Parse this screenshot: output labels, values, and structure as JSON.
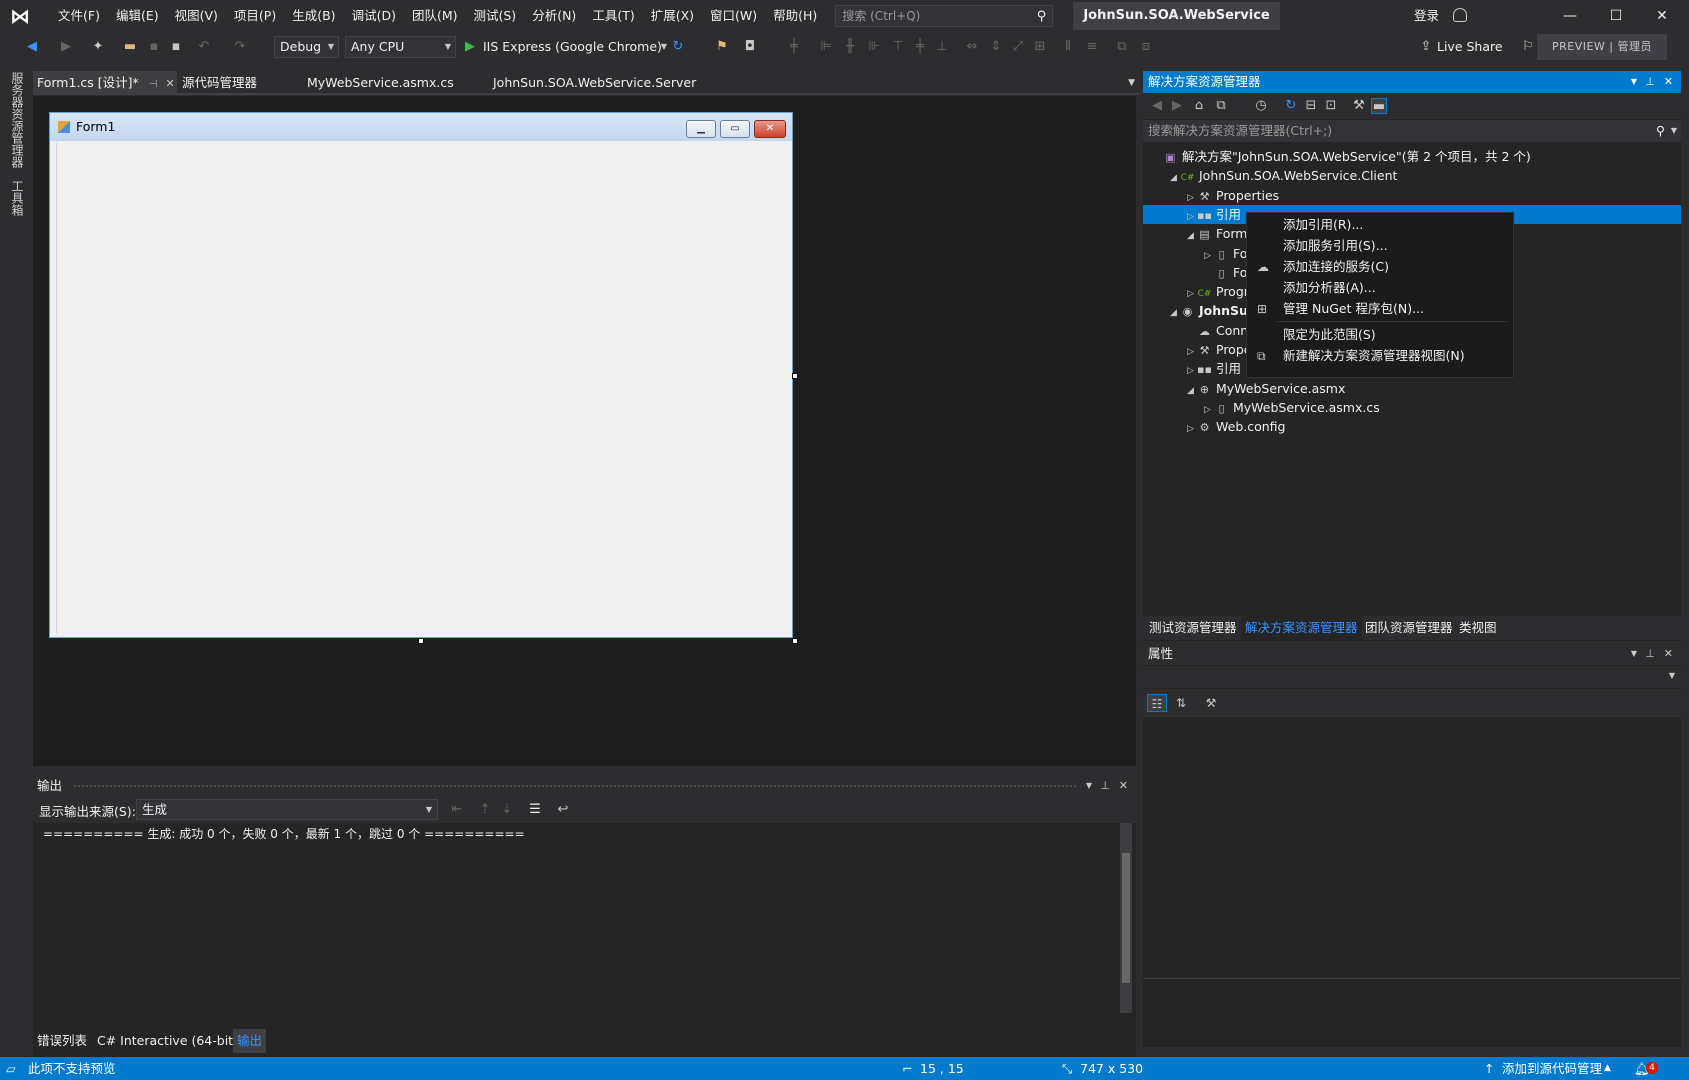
{
  "titlebar": {
    "menus": [
      "文件(F)",
      "编辑(E)",
      "视图(V)",
      "项目(P)",
      "生成(B)",
      "调试(D)",
      "团队(M)",
      "测试(S)",
      "分析(N)",
      "工具(T)",
      "扩展(X)",
      "窗口(W)",
      "帮助(H)"
    ],
    "search_placeholder": "搜索 (Ctrl+Q)",
    "solution_name": "JohnSun.SOA.WebService",
    "login": "登录"
  },
  "toolbar": {
    "config": "Debug",
    "platform": "Any CPU",
    "run_target": "IIS Express (Google Chrome)",
    "live_share": "Live Share",
    "preview": "PREVIEW | 管理员"
  },
  "leftbar": {
    "server_explorer": "服务器资源管理器",
    "toolbox": "工具箱"
  },
  "doc_tabs": [
    {
      "label": "Form1.cs [设计]*",
      "active": true
    },
    {
      "label": "源代码管理器",
      "active": false
    },
    {
      "label": "MyWebService.asmx.cs",
      "active": false
    },
    {
      "label": "JohnSun.SOA.WebService.Server",
      "active": false
    }
  ],
  "designer": {
    "form_title": "Form1"
  },
  "output": {
    "title": "输出",
    "source_label": "显示输出来源(S):",
    "source_value": "生成",
    "line": "========== 生成: 成功 0 个，失败 0 个，最新 1 个，跳过 0 个 =========="
  },
  "bottom_tabs": [
    "错误列表",
    "C# Interactive (64-bit)",
    "输出"
  ],
  "solution_explorer": {
    "title": "解决方案资源管理器",
    "search_placeholder": "搜索解决方案资源管理器(Ctrl+;)",
    "tree": [
      {
        "label": "解决方案\"JohnSun.SOA.WebService\"(第 2 个项目，共 2 个)",
        "icon": "solution-icon",
        "depth": 0,
        "expander": ""
      },
      {
        "label": "JohnSun.SOA.WebService.Client",
        "icon": "csharp-project-icon",
        "depth": 1,
        "expander": "◢"
      },
      {
        "label": "Properties",
        "icon": "wrench-icon",
        "depth": 2,
        "expander": "▷"
      },
      {
        "label": "引用",
        "icon": "references-icon",
        "depth": 2,
        "expander": "▷",
        "selected": true
      },
      {
        "label": "Form1.cs",
        "icon": "form-icon",
        "depth": 2,
        "expander": "◢"
      },
      {
        "label": "Form1.Designer.cs",
        "icon": "file-icon",
        "depth": 3,
        "expander": "▷"
      },
      {
        "label": "Form1.resx",
        "icon": "file-icon",
        "depth": 3,
        "expander": ""
      },
      {
        "label": "Program.cs",
        "icon": "csharp-file-icon",
        "depth": 2,
        "expander": "▷"
      },
      {
        "label": "JohnSun.SOA.WebService.Server",
        "icon": "web-project-icon",
        "depth": 1,
        "expander": "◢",
        "bold": true
      },
      {
        "label": "Connected Services",
        "icon": "connected-services-icon",
        "depth": 2,
        "expander": ""
      },
      {
        "label": "Properties",
        "icon": "wrench-icon",
        "depth": 2,
        "expander": "▷"
      },
      {
        "label": "引用",
        "icon": "references-icon",
        "depth": 2,
        "expander": "▷"
      },
      {
        "label": "MyWebService.asmx",
        "icon": "globe-icon",
        "depth": 2,
        "expander": "◢"
      },
      {
        "label": "MyWebService.asmx.cs",
        "icon": "file-icon",
        "depth": 3,
        "expander": "▷"
      },
      {
        "label": "Web.config",
        "icon": "config-icon",
        "depth": 2,
        "expander": "▷"
      }
    ],
    "tabs": [
      "测试资源管理器",
      "解决方案资源管理器",
      "团队资源管理器",
      "类视图"
    ]
  },
  "context_menu": [
    {
      "label": "添加引用(R)...",
      "icon": ""
    },
    {
      "label": "添加服务引用(S)...",
      "icon": ""
    },
    {
      "label": "添加连接的服务(C)",
      "icon": "connected-services-icon"
    },
    {
      "label": "添加分析器(A)...",
      "icon": ""
    },
    {
      "label": "管理 NuGet 程序包(N)...",
      "icon": "nuget-icon"
    },
    {
      "label": "限定为此范围(S)",
      "icon": ""
    },
    {
      "label": "新建解决方案资源管理器视图(N)",
      "icon": "new-view-icon"
    }
  ],
  "properties": {
    "title": "属性"
  },
  "statusbar": {
    "message": "此项不支持预览",
    "position": "15 , 15",
    "size": "747 x 530",
    "source_control": "添加到源代码管理",
    "notifications": "4"
  },
  "colors": {
    "accent": "#007acc",
    "background": "#2d2d30",
    "editor": "#1e1e1e"
  }
}
